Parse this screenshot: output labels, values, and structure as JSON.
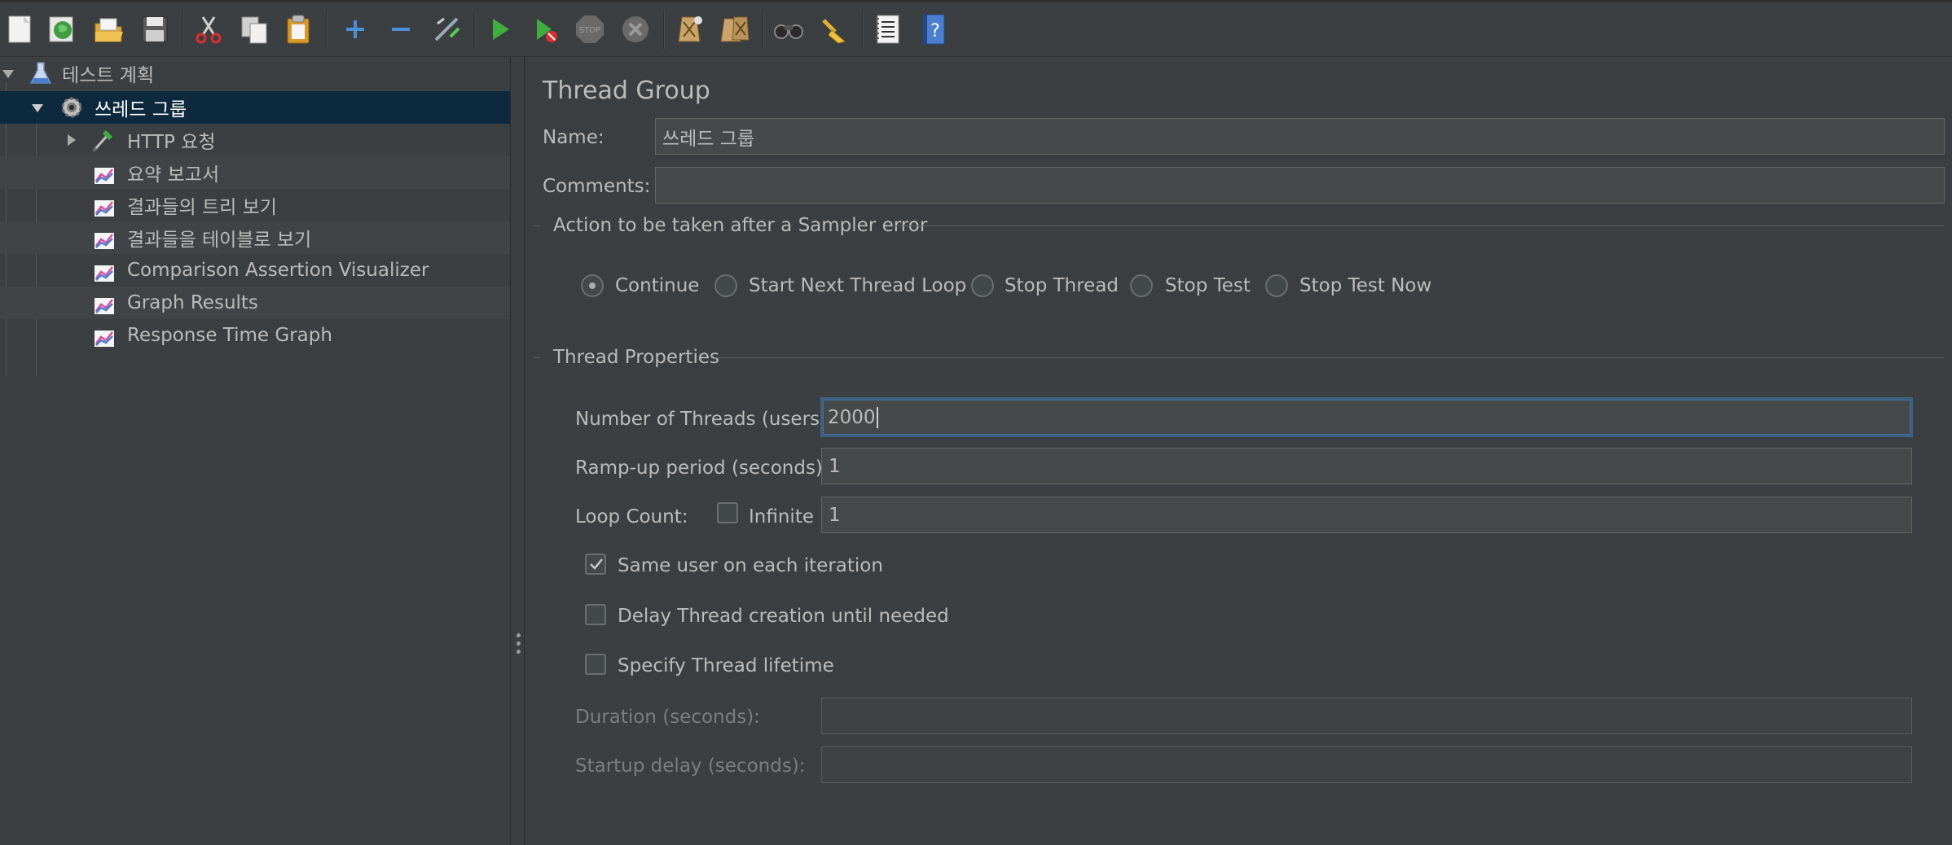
{
  "toolbar": {
    "buttons": [
      {
        "icon": "new-icon"
      },
      {
        "icon": "templates-icon"
      },
      {
        "icon": "open-icon"
      },
      {
        "icon": "save-icon"
      },
      {
        "icon": "cut-icon"
      },
      {
        "icon": "copy-icon"
      },
      {
        "icon": "paste-icon"
      },
      {
        "icon": "expand-icon"
      },
      {
        "icon": "collapse-icon"
      },
      {
        "icon": "toggle-icon"
      },
      {
        "icon": "start-icon"
      },
      {
        "icon": "start-no-pause-icon"
      },
      {
        "icon": "stop-icon"
      },
      {
        "icon": "shutdown-icon"
      },
      {
        "icon": "clear-icon"
      },
      {
        "icon": "clear-all-icon"
      },
      {
        "icon": "search-icon"
      },
      {
        "icon": "reset-search-icon"
      },
      {
        "icon": "function-helper-icon"
      },
      {
        "icon": "help-icon"
      }
    ],
    "stop_text": "STOP"
  },
  "tree": {
    "items": [
      {
        "label": "테스트 계획",
        "icon": "test-plan-icon"
      },
      {
        "label": "쓰레드 그룹",
        "icon": "thread-group-icon"
      },
      {
        "label": "HTTP 요청",
        "icon": "sampler-icon"
      },
      {
        "label": "요약 보고서",
        "icon": "listener-icon"
      },
      {
        "label": "결과들의 트리 보기",
        "icon": "listener-icon"
      },
      {
        "label": "결과들을 테이블로 보기",
        "icon": "listener-icon"
      },
      {
        "label": "Comparison Assertion Visualizer",
        "icon": "listener-icon"
      },
      {
        "label": "Graph Results",
        "icon": "listener-icon"
      },
      {
        "label": "Response Time Graph",
        "icon": "listener-icon"
      }
    ]
  },
  "panel": {
    "title": "Thread Group",
    "name_label": "Name:",
    "name_value": "쓰레드 그룹",
    "comments_label": "Comments:",
    "comments_value": "",
    "error_section_title": "Action to be taken after a Sampler error",
    "error_actions": [
      {
        "label": "Continue",
        "selected": true
      },
      {
        "label": "Start Next Thread Loop",
        "selected": false
      },
      {
        "label": "Stop Thread",
        "selected": false
      },
      {
        "label": "Stop Test",
        "selected": false
      },
      {
        "label": "Stop Test Now",
        "selected": false
      }
    ],
    "thread_section_title": "Thread Properties",
    "threads_label": "Number of Threads (users):",
    "threads_value": "2000",
    "rampup_label": "Ramp-up period (seconds):",
    "rampup_value": "1",
    "loop_label": "Loop Count:",
    "infinite_label": "Infinite",
    "infinite_checked": false,
    "loop_value": "1",
    "same_user_label": "Same user on each iteration",
    "same_user_checked": true,
    "delay_label": "Delay Thread creation until needed",
    "delay_checked": false,
    "lifetime_label": "Specify Thread lifetime",
    "lifetime_checked": false,
    "duration_label": "Duration (seconds):",
    "duration_value": "",
    "startup_label": "Startup delay (seconds):",
    "startup_value": ""
  }
}
